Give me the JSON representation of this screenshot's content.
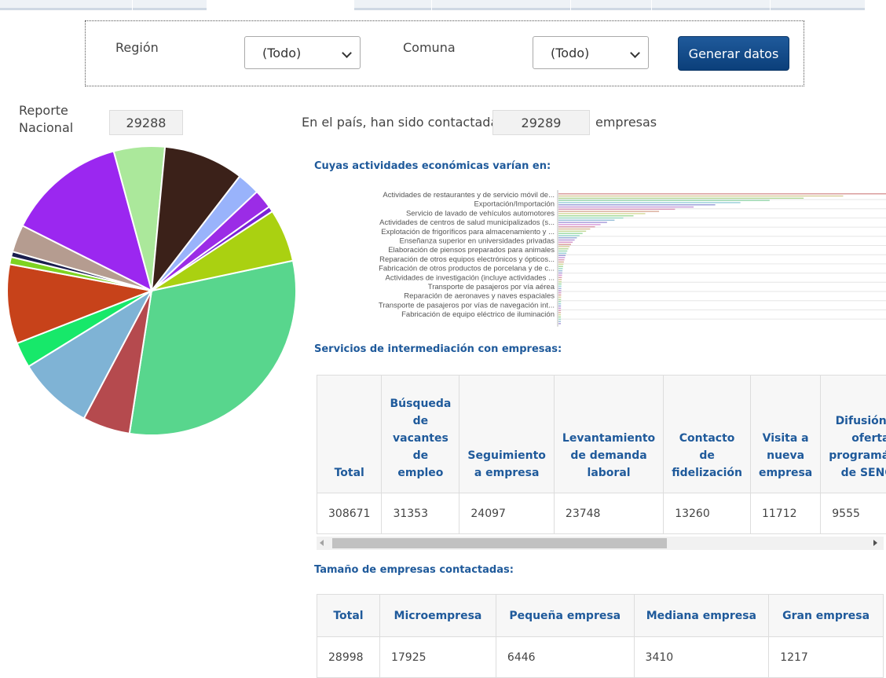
{
  "filters": {
    "region_label": "Región",
    "region_value": "(Todo)",
    "comuna_label": "Comuna",
    "comuna_value": "(Todo)",
    "generate_button": "Generar datos"
  },
  "national": {
    "label_line1": "Reporte",
    "label_line2": "Nacional",
    "value": "29288"
  },
  "country_sentence": {
    "prefix": "En el país, han sido contactadas",
    "value": "29289",
    "suffix": "empresas"
  },
  "sections": {
    "activities": "Cuyas actividades económicas varían en:",
    "services": "Servicios de intermediación con empresas:",
    "sizes": "Tamaño de empresas contactadas:"
  },
  "colors": {
    "accent": "#1f5a9b",
    "pie": [
      "#58d68d",
      "#b54a4e",
      "#7fb3d5",
      "#17e86a",
      "#c7421a",
      "#7ed321",
      "#1b1f4e",
      "#b59c90",
      "#9b27f0",
      "#abe89b",
      "#3b2119",
      "#99b3fb",
      "#9b2ce6",
      "#7a22d6",
      "#aad111"
    ]
  },
  "chart_data": [
    {
      "type": "pie",
      "title": "",
      "slices": [
        {
          "value": 30.2
        },
        {
          "value": 5.2
        },
        {
          "value": 8.3
        },
        {
          "value": 2.8
        },
        {
          "value": 8.7
        },
        {
          "value": 0.8
        },
        {
          "value": 0.6
        },
        {
          "value": 3.0
        },
        {
          "value": 13.1
        },
        {
          "value": 5.6
        },
        {
          "value": 8.8
        },
        {
          "value": 2.5
        },
        {
          "value": 2.1
        },
        {
          "value": 0.6
        },
        {
          "value": 5.8
        }
      ]
    },
    {
      "type": "bar",
      "title": "",
      "categories": [
        "Actividades de restaurantes y de servicio móvil de...",
        "Exportación/Importación",
        "Servicio de lavado de vehículos automotores",
        "Actividades de centros de salud municipalizados (s...",
        "Explotación de frigoríficos para almacenamiento y ...",
        "Enseñanza superior en universidades privadas",
        "Elaboración de piensos preparados para animales",
        "Reparación de otros equipos electrónicos y ópticos...",
        "Fabricación de otros productos de porcelana y de c...",
        "Actividades de investigación (incluye actividades ...",
        "Transporte de pasajeros por vía aérea",
        "Reparación de aeronaves y naves espaciales",
        "Transporte de pasajeros por vías de navegación int...",
        "Fabricación de equipo eléctrico de iluminación"
      ]
    }
  ],
  "services_table": {
    "headers": [
      "Total",
      "Búsqueda de vacantes de empleo",
      "Seguimiento a empresa",
      "Levantamiento de demanda laboral",
      "Contacto de fidelización",
      "Visita a nueva empresa",
      "Difusión de oferta programática de SENCE"
    ],
    "header_lines": [
      [
        "Total"
      ],
      [
        "Búsqueda",
        "de",
        "vacantes",
        "de",
        "empleo"
      ],
      [
        "Seguimiento",
        "a empresa"
      ],
      [
        "Levantamiento",
        "de demanda",
        "laboral"
      ],
      [
        "Contacto",
        "de",
        "fidelización"
      ],
      [
        "Visita a",
        "nueva",
        "empresa"
      ],
      [
        "Difusión de",
        "oferta",
        "programática",
        "de SENCE"
      ]
    ],
    "values": [
      "308671",
      "31353",
      "24097",
      "23748",
      "13260",
      "11712",
      "9555"
    ]
  },
  "sizes_table": {
    "headers": [
      "Total",
      "Microempresa",
      "Pequeña empresa",
      "Mediana empresa",
      "Gran empresa"
    ],
    "values": [
      "28998",
      "17925",
      "6446",
      "3410",
      "1217"
    ]
  }
}
